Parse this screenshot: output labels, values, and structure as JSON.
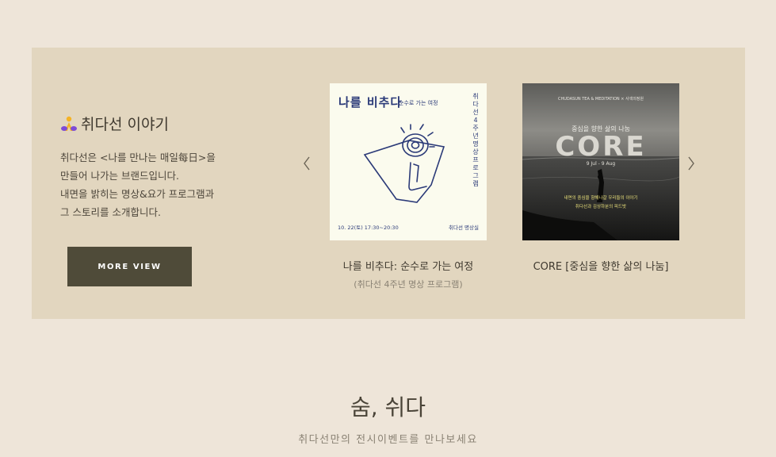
{
  "story": {
    "heading": "취다선 이야기",
    "description": [
      "취다선은 <나를 만나는 매일每日>을",
      "만들어 나가는 브랜드입니다.",
      "내면을 밝히는 명상&요가 프로그램과",
      "그 스토리를 소개합니다."
    ],
    "more_button": "MORE VIEW"
  },
  "cards": [
    {
      "title": "나를 비추다: 순수로 가는 여정",
      "subtitle": "(취다선 4주년 명상 프로그램)",
      "poster": {
        "title": "나를 비추다",
        "subtitle": "순수로 가는 여정",
        "vertical": "취다선 4주년 명상 프로그램",
        "date": "10. 22(토) 17:30~20:30",
        "org": "취다선 명상실"
      }
    },
    {
      "title": "CORE [중심을 향한 삶의 나눔]",
      "subtitle": "",
      "poster": {
        "brand": "CHUDASUN TEA & MEDITATION × 사색의정원",
        "tagline": "중심을 향한 삶의 나눔",
        "big": "CORE",
        "dates": "9 Jul - 9 Aug",
        "line1": "내면의 중심을 향해나갈 우리들의 이야기",
        "line2": "취다선과 김상하분의 피드밧"
      }
    }
  ],
  "section": {
    "title": "숨, 쉬다",
    "subtitle": "취다선만의 전시이벤트를 만나보세요"
  },
  "icons": {
    "heading_icon": "pray-icon",
    "prev": "chevron-left-icon",
    "next": "chevron-right-icon"
  },
  "colors": {
    "page_bg": "#eee5d9",
    "panel_bg": "#e2d6bf",
    "button_bg": "#4f4b39",
    "poster_ink": "#2b3a78"
  }
}
